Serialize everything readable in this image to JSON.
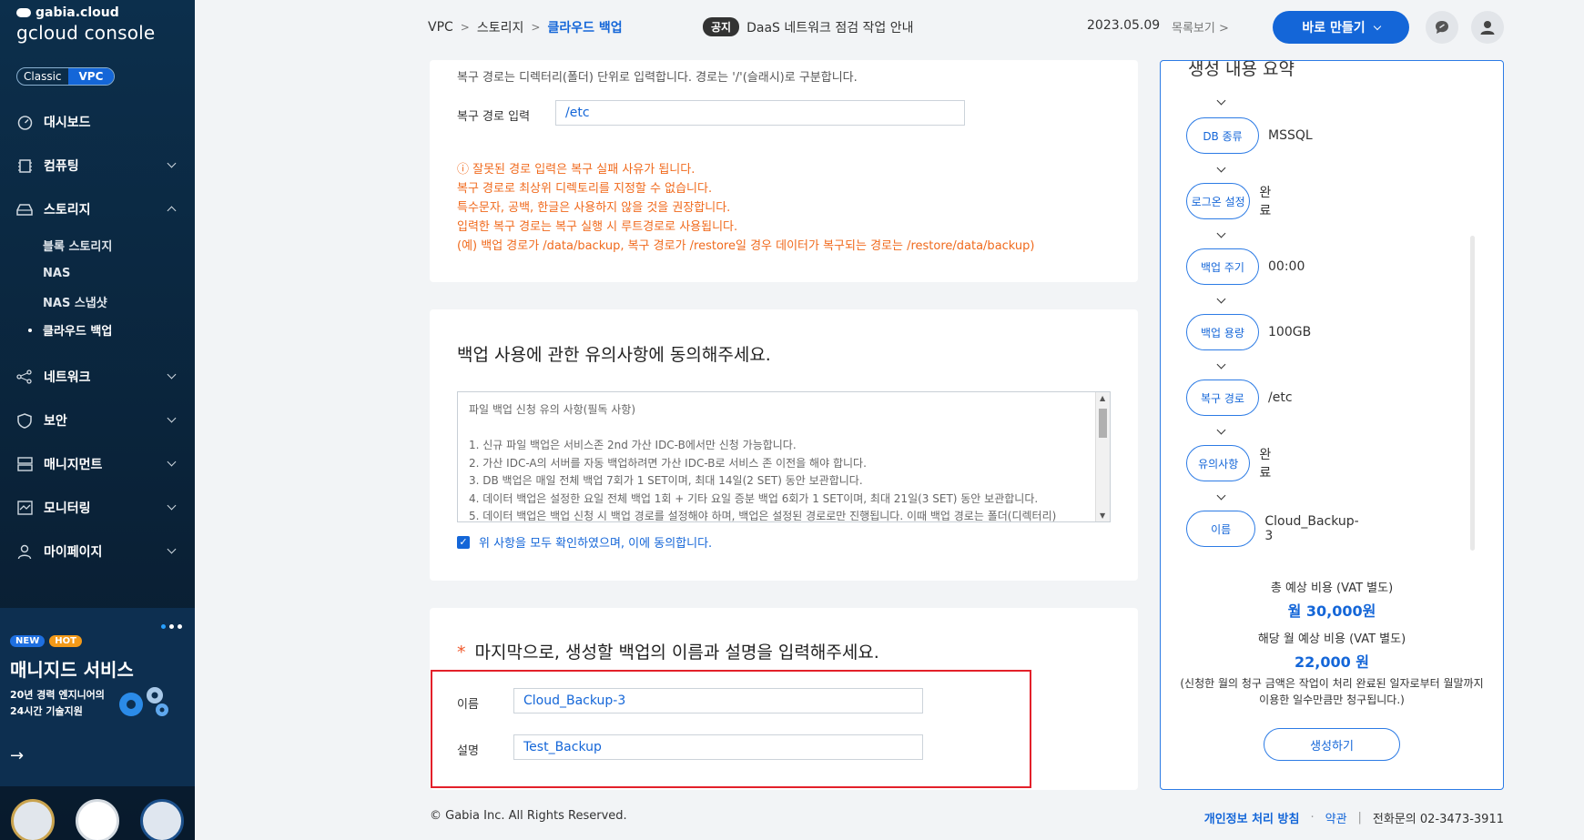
{
  "brand": {
    "small": "gabia.cloud",
    "big": "gcloud console"
  },
  "mode_toggle": {
    "classic": "Classic",
    "vpc": "VPC"
  },
  "sidebar": {
    "items": [
      {
        "label": "대시보드"
      },
      {
        "label": "컴퓨팅"
      },
      {
        "label": "스토리지"
      },
      {
        "label": "네트워크"
      },
      {
        "label": "보안"
      },
      {
        "label": "매니지먼트"
      },
      {
        "label": "모니터링"
      },
      {
        "label": "마이페이지"
      }
    ],
    "storage_sub": [
      "블록 스토리지",
      "NAS",
      "NAS 스냅샷",
      "클라우드 백업"
    ]
  },
  "promo": {
    "badge_new": "NEW",
    "badge_hot": "HOT",
    "title": "매니지드 서비스",
    "desc_line1": "20년 경력 엔지니어의",
    "desc_line2": "24시간 기술지원",
    "arrow": "→"
  },
  "breadcrumb": {
    "item1": "VPC",
    "item2": "스토리지",
    "current": "클라우드 백업",
    "sep": ">"
  },
  "notice": {
    "tag": "공지",
    "text": "DaaS 네트워크 점검 작업 안내",
    "date": "2023.05.09",
    "more": "목록보기 >"
  },
  "header": {
    "create_label": "바로 만들기"
  },
  "restore": {
    "desc": "복구 경로는 디렉터리(폴더) 단위로 입력합니다. 경로는 '/'(슬래시)로 구분합니다.",
    "label": "복구 경로 입력",
    "value": "/etc",
    "warnings": [
      "ⓘ 잘못된 경로 입력은 복구 실패 사유가 됩니다.",
      "복구 경로로 최상위 디렉토리를 지정할 수 없습니다.",
      "특수문자, 공백, 한글은 사용하지 않을 것을 권장합니다.",
      "입력한 복구 경로는 복구 실행 시 루트경로로 사용됩니다.",
      "(예) 백업 경로가 /data/backup, 복구 경로가 /restore일 경우 데이터가 복구되는 경로는 /restore/data/backup)"
    ]
  },
  "agreement": {
    "title": "백업 사용에 관한 유의사항에 동의해주세요.",
    "terms": [
      "파일 백업 신청 유의 사항(필독 사항)",
      "",
      "1. 신규 파일 백업은 서비스존 2nd 가산 IDC-B에서만 신청 가능합니다.",
      "2. 가산 IDC-A의 서버를 자동 백업하려면 가산 IDC-B로 서비스 존 이전을 해야 합니다.",
      "3. DB 백업은 매일 전체 백업 7회가 1 SET이며, 최대 14일(2 SET) 동안 보관합니다.",
      "4. 데이터 백업은 설정한 요일 전체 백업 1회 + 기타 요일 증분 백업 6회가 1 SET이며, 최대 21일(3 SET) 동안 보관합니다.",
      "5. 데이터 백업은 백업 신청 시 백업 경로를 설정해야 하며, 백업은 설정된 경로로만 진행됩니다. 이때 백업 경로는 폴더(디렉터리)"
    ],
    "agree_text": "위 사항을 모두 확인하였으며, 이에 동의합니다."
  },
  "final": {
    "star": "*",
    "title": "마지막으로, 생성할 백업의 이름과 설명을 입력해주세요.",
    "name_label": "이름",
    "name_value": "Cloud_Backup-3",
    "desc_label": "설명",
    "desc_value": "Test_Backup"
  },
  "summary": {
    "title": "생성 내용 요약",
    "steps": [
      {
        "label": "DB 종류",
        "value": "MSSQL"
      },
      {
        "label": "로그온 설정",
        "value": "완료"
      },
      {
        "label": "백업 주기",
        "value": "00:00"
      },
      {
        "label": "백업 용량",
        "value": "100GB"
      },
      {
        "label": "복구 경로",
        "value": "/etc"
      },
      {
        "label": "유의사항",
        "value": "완료"
      },
      {
        "label": "이름",
        "value": "Cloud_Backup-3"
      }
    ],
    "total_label": "총 예상 비용 (VAT 별도)",
    "total_value": "월 30,000원",
    "month_label": "해당 월 예상 비용 (VAT 별도)",
    "month_value": "22,000 원",
    "note": "(신청한 월의 청구 금액은 작업이 처리 완료된 일자로부터 월말까지 이용한 일수만큼만 청구됩니다.)",
    "generate_label": "생성하기"
  },
  "footer": {
    "copyright": "© Gabia Inc. All Rights Reserved.",
    "privacy": "개인정보 처리 방침",
    "dot": "·",
    "terms": "약관",
    "bar": "|",
    "phone": "전화문의  02-3473-3911"
  },
  "colors": {
    "accent": "#1466d8",
    "warning": "#f06a1d",
    "sidebar_bg": "#0c2f4c",
    "highlight_box": "#e3202a"
  }
}
